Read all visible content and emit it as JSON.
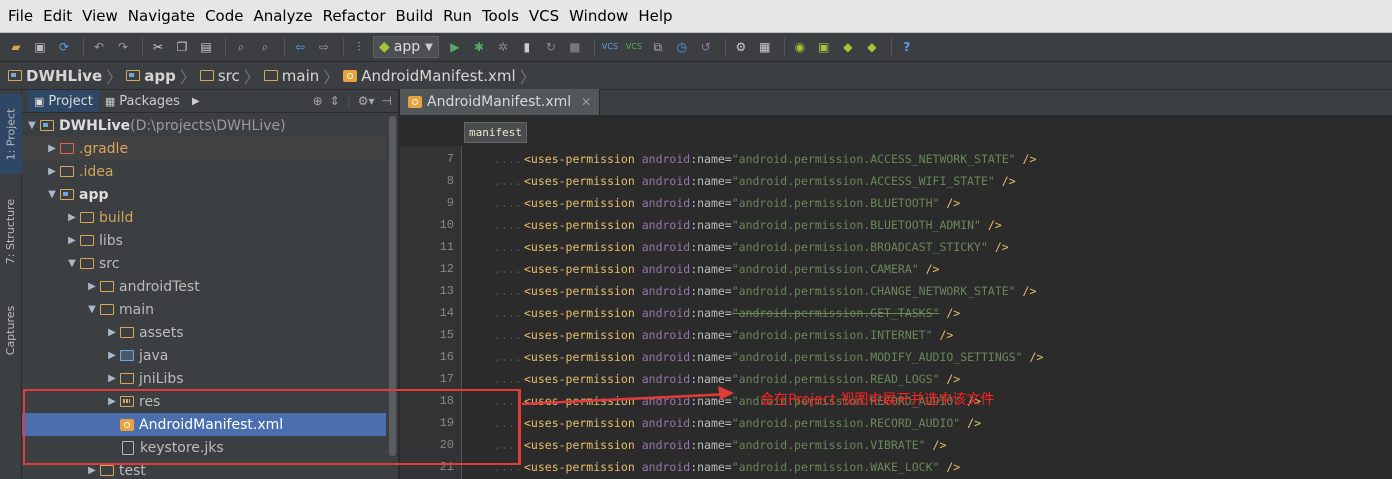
{
  "menubar": {
    "items": [
      "File",
      "Edit",
      "View",
      "Navigate",
      "Code",
      "Analyze",
      "Refactor",
      "Build",
      "Run",
      "Tools",
      "VCS",
      "Window",
      "Help"
    ]
  },
  "toolbar": {
    "run_config": "app",
    "icons": [
      "open-icon",
      "save-icon",
      "sync-icon",
      "undo-icon",
      "redo-icon",
      "cut-icon",
      "copy-icon",
      "paste-icon",
      "find-icon",
      "replace-icon",
      "back-icon",
      "forward-icon",
      "make-icon",
      "run-icon",
      "debug-icon",
      "attach-debugger-icon",
      "coverage-icon",
      "rerun-icon",
      "stop-icon",
      "vcs-update-icon",
      "vcs-commit-icon",
      "vcs-compare-icon",
      "vcs-history-icon",
      "vcs-revert-icon",
      "settings-icon",
      "project-structure-icon",
      "android-monitor-icon",
      "sdk-manager-icon",
      "avd-manager-icon",
      "android-icon",
      "help-icon"
    ]
  },
  "breadcrumb": {
    "items": [
      {
        "label": "DWHLive",
        "bold": true
      },
      {
        "label": "app",
        "bold": true
      },
      {
        "label": "src",
        "bold": false
      },
      {
        "label": "main",
        "bold": false
      },
      {
        "label": "AndroidManifest.xml",
        "bold": false
      }
    ]
  },
  "side_tabs": {
    "project": "1: Project",
    "structure": "7: Structure",
    "captures": "Captures"
  },
  "project_panel": {
    "tab_project": "Project",
    "tab_packages": "Packages",
    "tree": [
      {
        "label": "DWHLive",
        "suffix": " (D:\\projects\\DWHLive)",
        "expanded": true
      },
      {
        "label": ".gradle",
        "expanded": false
      },
      {
        "label": ".idea",
        "expanded": false
      },
      {
        "label": "app",
        "expanded": true
      },
      {
        "label": "build",
        "expanded": false
      },
      {
        "label": "libs",
        "expanded": false
      },
      {
        "label": "src",
        "expanded": true
      },
      {
        "label": "androidTest",
        "expanded": false
      },
      {
        "label": "main",
        "expanded": true
      },
      {
        "label": "assets",
        "expanded": false
      },
      {
        "label": "java",
        "expanded": false
      },
      {
        "label": "jniLibs",
        "expanded": false
      },
      {
        "label": "res",
        "expanded": false
      },
      {
        "label": "AndroidManifest.xml",
        "selected": true
      },
      {
        "label": "keystore.jks"
      },
      {
        "label": "test",
        "expanded": false
      }
    ]
  },
  "editor": {
    "tab_label": "AndroidManifest.xml",
    "xml_breadcrumb": "manifest",
    "lines": [
      {
        "no": "7",
        "value": "\"android.permission.ACCESS_NETWORK_STATE\""
      },
      {
        "no": "8",
        "value": "\"android.permission.ACCESS_WIFI_STATE\""
      },
      {
        "no": "9",
        "value": "\"android.permission.BLUETOOTH\""
      },
      {
        "no": "10",
        "value": "\"android.permission.BLUETOOTH_ADMIN\""
      },
      {
        "no": "11",
        "value": "\"android.permission.BROADCAST_STICKY\""
      },
      {
        "no": "12",
        "value": "\"android.permission.CAMERA\""
      },
      {
        "no": "13",
        "value": "\"android.permission.CHANGE_NETWORK_STATE\""
      },
      {
        "no": "14",
        "value": "\"android.permission.GET_TASKS\"",
        "strike": true
      },
      {
        "no": "15",
        "value": "\"android.permission.INTERNET\""
      },
      {
        "no": "16",
        "value": "\"android.permission.MODIFY_AUDIO_SETTINGS\""
      },
      {
        "no": "17",
        "value": "\"android.permission.READ_LOGS\""
      },
      {
        "no": "18",
        "value": "\"android.permission.RECORD_AUDIO\""
      },
      {
        "no": "19",
        "value": "\"android.permission.RECORD_AUDIO\""
      },
      {
        "no": "20",
        "value": "\"android.permission.VIBRATE\""
      },
      {
        "no": "21",
        "value": "\"android.permission.WAKE_LOCK\""
      }
    ],
    "tag_open": "<uses-permission",
    "attr_ns": "android",
    "attr_name": ":name=",
    "tag_close": " />"
  },
  "annotation": {
    "text": "会在Project 视图中展开并选中该文件",
    "color": "#e23b3b"
  }
}
